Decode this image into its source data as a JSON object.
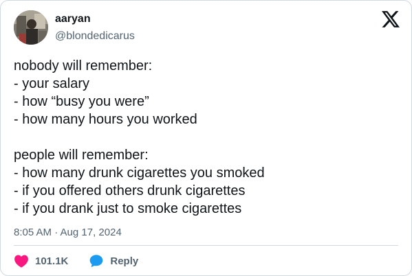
{
  "author": {
    "name": "aaryan",
    "handle": "@blondedicarus",
    "avatar_icon": "profile-photo"
  },
  "brand": {
    "logo_icon": "x-logo-icon",
    "color": "#0f1419"
  },
  "tweet": {
    "lines": [
      "nobody will remember:",
      "- your salary",
      "- how “busy you were”",
      "- how many hours you worked",
      "",
      "people will remember:",
      "- how many drunk cigarettes you smoked",
      "- if you offered others drunk cigarettes",
      "- if you drank just to smoke cigarettes"
    ],
    "timestamp": "8:05 AM · Aug 17, 2024"
  },
  "actions": {
    "like": {
      "count": "101.1K",
      "icon": "heart-icon",
      "color": "#f91880"
    },
    "reply": {
      "label": "Reply",
      "icon": "reply-bubble-icon",
      "color": "#1d9bf0"
    }
  },
  "colors": {
    "text": "#0f1419",
    "secondary": "#536471",
    "border": "#cfd9de"
  }
}
